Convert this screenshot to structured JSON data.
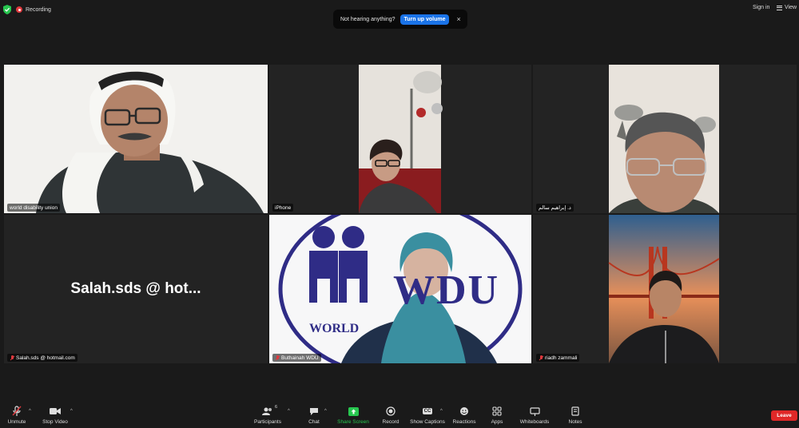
{
  "topbar": {
    "recording_label": "Recording",
    "signin_label": "Sign in",
    "view_label": "View"
  },
  "notice": {
    "message": "Not hearing anything?",
    "action_label": "Turn up volume",
    "close_glyph": "×"
  },
  "tiles": {
    "t1": {
      "name": "world disability union"
    },
    "t2": {
      "name": "iPhone"
    },
    "t3": {
      "name": "د. إبراهيم سالم"
    },
    "t4": {
      "name": "Salah.sds @ hotmail.com",
      "display_text": "Salah.sds @ hot..."
    },
    "t5": {
      "name": "Buthainah WDU"
    },
    "t6": {
      "name": "riadh zammali"
    }
  },
  "wdu_logo": {
    "text_big": "WDU",
    "text_world": "WORLD"
  },
  "toolbar": {
    "unmute": "Unmute",
    "stop_video": "Stop Video",
    "participants": "Participants",
    "participants_count": "6",
    "chat": "Chat",
    "share_screen": "Share Screen",
    "record": "Record",
    "captions": "Show Captions",
    "captions_icon_text": "CC",
    "reactions": "Reactions",
    "apps": "Apps",
    "whiteboards": "Whiteboards",
    "notes": "Notes",
    "leave": "Leave",
    "caret_glyph": "^"
  },
  "colors": {
    "active_speaker": "#c8e64a",
    "share_green": "#27c64f",
    "leave_red": "#e02828",
    "notice_button": "#1a73e8"
  }
}
